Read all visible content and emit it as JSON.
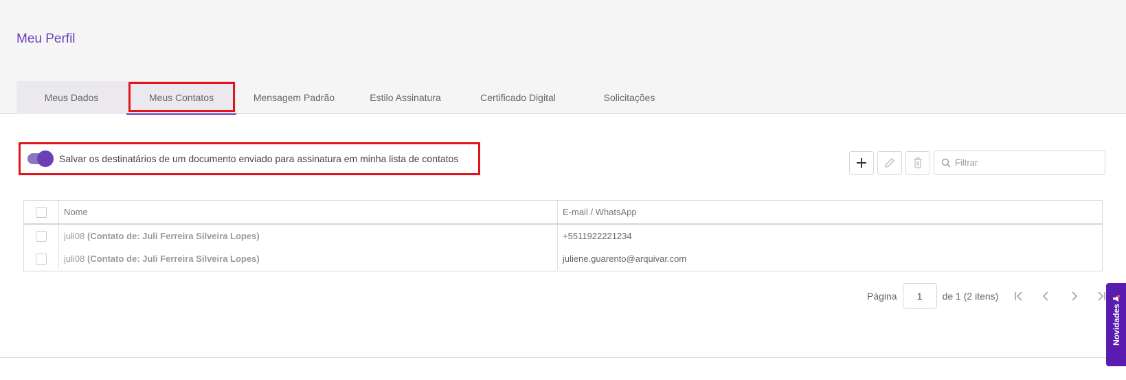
{
  "page": {
    "title": "Meu Perfil"
  },
  "tabs": [
    {
      "label": "Meus Dados"
    },
    {
      "label": "Meus Contatos"
    },
    {
      "label": "Mensagem Padrão"
    },
    {
      "label": "Estilo Assinatura"
    },
    {
      "label": "Certificado Digital"
    },
    {
      "label": "Solicitações"
    }
  ],
  "toggle": {
    "label": "Salvar os destinatários de um documento enviado para assinatura em minha lista de contatos",
    "state": "on"
  },
  "toolbar": {
    "add_icon": "plus-icon",
    "edit_icon": "pencil-icon",
    "delete_icon": "trash-icon",
    "filter_placeholder": "Filtrar"
  },
  "table": {
    "columns": [
      "Nome",
      "E-mail / WhatsApp"
    ],
    "rows": [
      {
        "name": "juli08",
        "contact_of": "(Contato de: Juli Ferreira Silveira Lopes)",
        "email": "+5511922221234"
      },
      {
        "name": "juli08",
        "contact_of": "(Contato de: Juli Ferreira Silveira Lopes)",
        "email": "juliene.guarento@arquivar.com"
      }
    ]
  },
  "pager": {
    "label": "Página",
    "current": "1",
    "summary": "de 1 (2 itens)"
  },
  "novidades": {
    "label": "Novidades"
  },
  "colors": {
    "accent": "#6a3fb8",
    "highlight": "#e0141a",
    "novidades": "#5a1bb0"
  }
}
